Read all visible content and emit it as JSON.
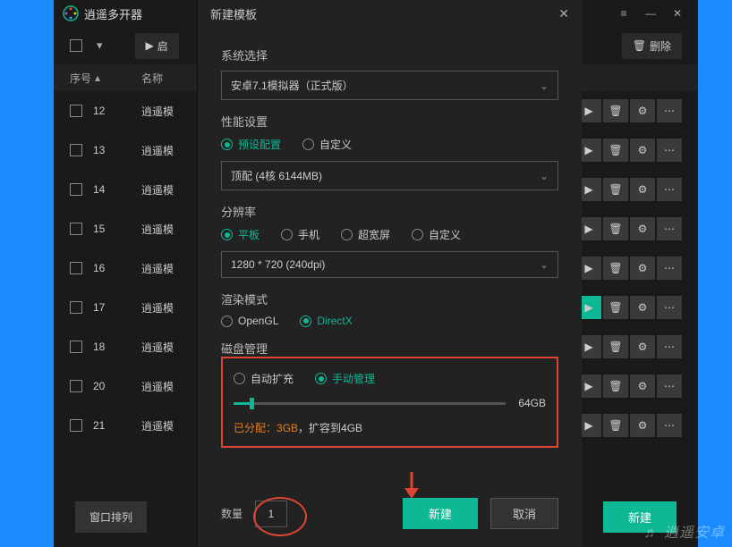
{
  "app": {
    "title": "逍遥多开器"
  },
  "toolbar": {
    "start": "启",
    "delete_label": "删除"
  },
  "table": {
    "col_seq": "序号",
    "col_name": "名称",
    "rows": [
      {
        "seq": "12",
        "name": "逍遥模"
      },
      {
        "seq": "13",
        "name": "逍遥模"
      },
      {
        "seq": "14",
        "name": "逍遥模"
      },
      {
        "seq": "15",
        "name": "逍遥模"
      },
      {
        "seq": "16",
        "name": "逍遥模"
      },
      {
        "seq": "17",
        "name": "逍遥模"
      },
      {
        "seq": "18",
        "name": "逍遥模"
      },
      {
        "seq": "20",
        "name": "逍遥模"
      },
      {
        "seq": "21",
        "name": "逍遥模"
      }
    ]
  },
  "bottom": {
    "arrange": "窗口排列",
    "create": "新建"
  },
  "dialog": {
    "title": "新建模板",
    "sys_label": "系统选择",
    "sys_value": "安卓7.1模拟器（正式版）",
    "perf_label": "性能设置",
    "perf_preset": "预设配置",
    "perf_custom": "自定义",
    "perf_value": "顶配 (4核 6144MB)",
    "res_label": "分辨率",
    "res_tablet": "平板",
    "res_phone": "手机",
    "res_wide": "超宽屏",
    "res_custom": "自定义",
    "res_value": "1280 * 720 (240dpi)",
    "render_label": "渲染模式",
    "render_gl": "OpenGL",
    "render_dx": "DirectX",
    "disk_label": "磁盘管理",
    "disk_auto": "自动扩充",
    "disk_manual": "手动管理",
    "disk_max": "64GB",
    "alloc_prefix": "已分配：",
    "alloc_val": "3GB",
    "alloc_suffix": "，扩容到4GB",
    "qty_label": "数量",
    "qty_value": "1",
    "btn_create": "新建",
    "btn_cancel": "取消"
  },
  "watermark": "♬ 逍遥安卓"
}
